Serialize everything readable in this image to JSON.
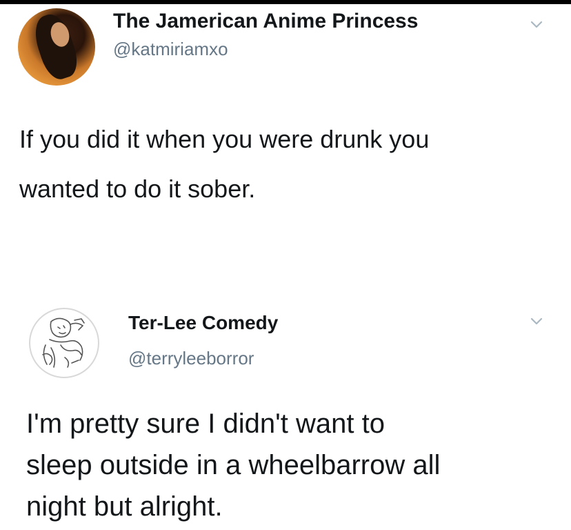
{
  "tweets": [
    {
      "display_name": "The Jamerican Anime Princess",
      "handle": "@katmiriamxo",
      "text": "If you did it when you were drunk you\nwanted to do it sober.",
      "avatar_icon": "profile-photo-woman",
      "menu_icon": "chevron-down-icon"
    },
    {
      "display_name": "Ter-Lee Comedy",
      "handle": "@terryleeborror",
      "text": "I'm pretty sure I didn't want to\nsleep outside in a wheelbarrow all\nnight but alright.",
      "avatar_icon": "profile-sketch-drawing",
      "menu_icon": "chevron-down-icon"
    }
  ],
  "colors": {
    "text": "#14171a",
    "handle": "#657786",
    "chevron": "#aab8c2",
    "background": "#ffffff"
  }
}
